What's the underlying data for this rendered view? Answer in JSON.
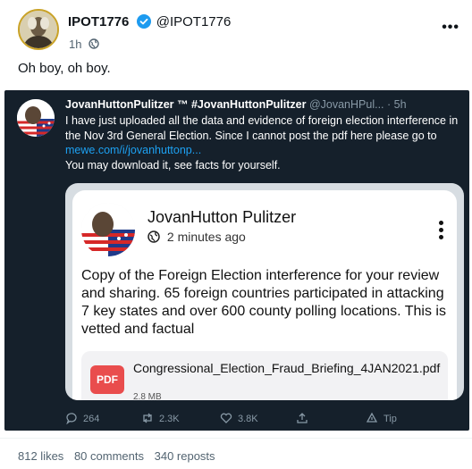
{
  "post": {
    "display_name": "IPOT1776",
    "username": "@IPOT1776",
    "time": "1h",
    "visibility_icon": "globe-icon",
    "more_label": "•••",
    "text": "Oh boy, oh boy."
  },
  "embed": {
    "display_name": "JovanHuttonPulitzer ™ #JovanHuttonPulitzer",
    "handle_time": "@JovanHPul... · 5h",
    "body_line1": "I have just uploaded all the data and evidence of foreign election interference in the Nov 3rd General Election.  Since I cannot post the pdf here please go to ",
    "link": "mewe.com/i/jovanhuttonp...",
    "body_line2": "You may download it, see facts for yourself.",
    "card": {
      "name": "JovanHutton Pulitzer",
      "time": "2 minutes ago",
      "text": "Copy of the Foreign Election interference for your review and sharing.  65 foreign countries participated in attacking 7 key states and over 600 county polling locations. This is vetted and factual",
      "attachment_icon_label": "PDF",
      "attachment_name": "Congressional_Election_Fraud_Briefing_4JAN2021.pdf",
      "attachment_size": "2.8 MB"
    },
    "actions": {
      "replies": "264",
      "retweets": "2.3K",
      "likes": "3.8K",
      "tip": "Tip"
    }
  },
  "stats": {
    "likes": "812 likes",
    "comments": "80 comments",
    "reposts": "340 reposts"
  },
  "colors": {
    "verified": "#1d9bf0",
    "embed_bg": "#15202b",
    "link": "#1da1f2",
    "pdf_red": "#e94d4d"
  }
}
